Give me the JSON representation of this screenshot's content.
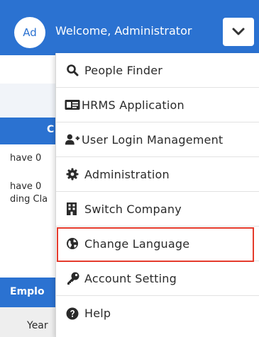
{
  "header": {
    "avatar_initials": "Ad",
    "welcome_text": "Welcome, Administrator",
    "accent_color": "#2b72d1"
  },
  "background": {
    "blue_header_fragment": "C",
    "lines": [
      "have 0",
      "have 0",
      "ding Cla"
    ],
    "section_title_fragment": "Emplo",
    "column_fragment": "Year"
  },
  "menu": {
    "items": [
      {
        "label": "People Finder",
        "icon": "search-icon"
      },
      {
        "label": "HRMS Application",
        "icon": "id-card-icon"
      },
      {
        "label": "User Login Management",
        "icon": "user-plus-icon"
      },
      {
        "label": "Administration",
        "icon": "gear-icon"
      },
      {
        "label": "Switch Company",
        "icon": "building-icon"
      },
      {
        "label": "Change Language",
        "icon": "globe-icon"
      },
      {
        "label": "Account Setting",
        "icon": "key-icon"
      },
      {
        "label": "Help",
        "icon": "question-icon"
      }
    ],
    "highlighted_item": "Change Language",
    "highlight_color": "#e53b2c"
  }
}
